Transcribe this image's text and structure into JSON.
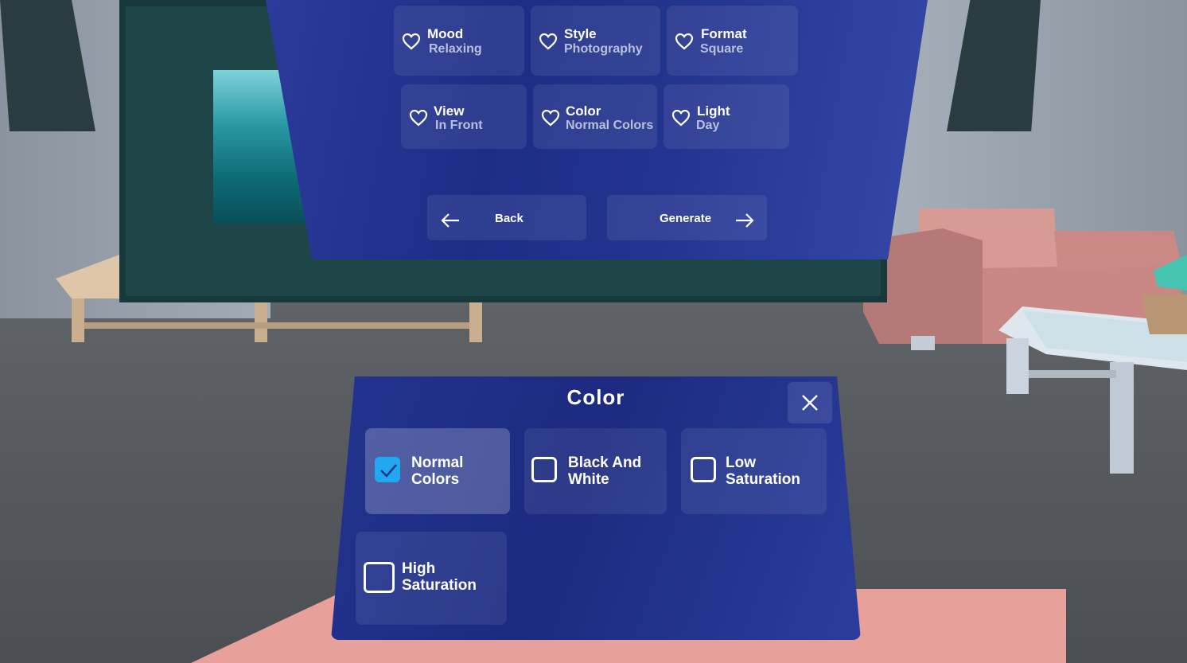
{
  "main_panel": {
    "preferences": [
      {
        "label": "Mood",
        "value": "Relaxing"
      },
      {
        "label": "Style",
        "value": "Photography"
      },
      {
        "label": "Format",
        "value": "Square"
      },
      {
        "label": "View",
        "value": "In Front"
      },
      {
        "label": "Color",
        "value": "Normal Colors"
      },
      {
        "label": "Light",
        "value": "Day"
      }
    ],
    "back_label": "Back",
    "generate_label": "Generate"
  },
  "color_dialog": {
    "title": "Color",
    "options": [
      {
        "line1": "Normal",
        "line2": "Colors",
        "checked": true
      },
      {
        "line1": "Black And",
        "line2": "White",
        "checked": false
      },
      {
        "line1": "Low",
        "line2": "Saturation",
        "checked": false
      },
      {
        "line1": "High",
        "line2": "Saturation",
        "checked": false
      }
    ]
  },
  "icons": {
    "preference": "heart-outline-icon",
    "back": "arrow-left-icon",
    "generate": "arrow-right-icon",
    "close": "close-x-icon",
    "check": "check-icon"
  },
  "colors": {
    "panel": "#1d2d86",
    "checkbox_selected": "#22a8f0",
    "secondary_text": "#b9c0dd"
  }
}
